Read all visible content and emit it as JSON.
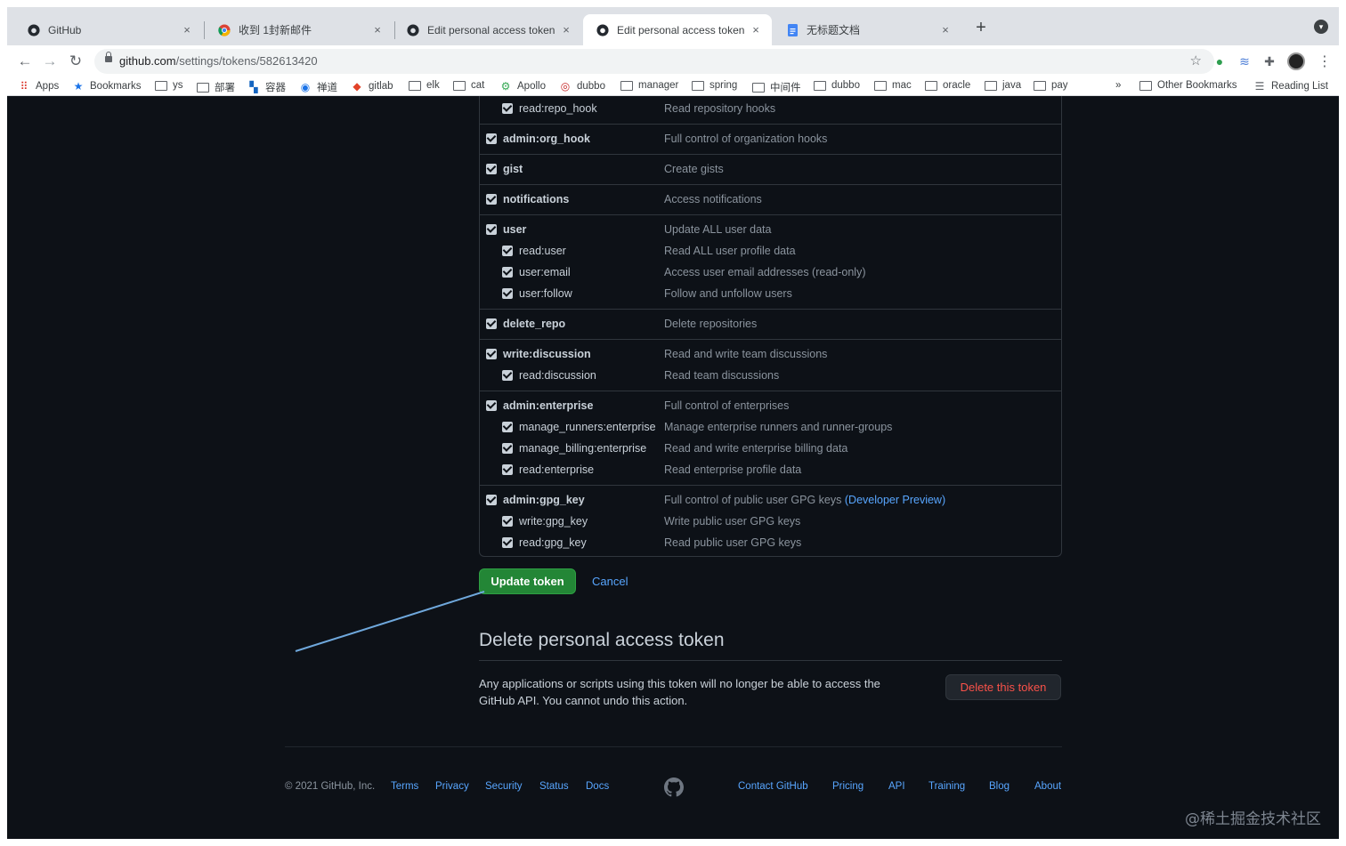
{
  "browser": {
    "tabs": [
      {
        "title": "GitHub",
        "icon": "github-icon",
        "active": false
      },
      {
        "title": "收到 1封新邮件",
        "icon": "chrome-icon",
        "active": false
      },
      {
        "title": "Edit personal access token",
        "icon": "github-icon",
        "active": false
      },
      {
        "title": "Edit personal access token",
        "icon": "github-icon",
        "active": true
      },
      {
        "title": "无标题文档",
        "icon": "docs-icon",
        "active": false
      }
    ],
    "tab_close": "×",
    "new_tab": "+",
    "address": {
      "host": "github.com",
      "path": "/settings/tokens/582613420"
    },
    "bookmarks": [
      {
        "label": "Apps",
        "icon": "apps-icon"
      },
      {
        "label": "Bookmarks",
        "icon": "star-icon"
      },
      {
        "label": "ys",
        "icon": "folder-icon"
      },
      {
        "label": "部署",
        "icon": "folder-icon"
      },
      {
        "label": "容器",
        "icon": "network-icon"
      },
      {
        "label": "禅道",
        "icon": "zentao-icon"
      },
      {
        "label": "gitlab",
        "icon": "gitlab-icon"
      },
      {
        "label": "elk",
        "icon": "folder-icon"
      },
      {
        "label": "cat",
        "icon": "folder-icon"
      },
      {
        "label": "Apollo",
        "icon": "apollo-icon"
      },
      {
        "label": "dubbo",
        "icon": "dubbo-icon"
      },
      {
        "label": "manager",
        "icon": "folder-icon"
      },
      {
        "label": "spring",
        "icon": "folder-icon"
      },
      {
        "label": "中间件",
        "icon": "folder-icon"
      },
      {
        "label": "dubbo",
        "icon": "folder-icon"
      },
      {
        "label": "mac",
        "icon": "folder-icon"
      },
      {
        "label": "oracle",
        "icon": "folder-icon"
      },
      {
        "label": "java",
        "icon": "folder-icon"
      },
      {
        "label": "pay",
        "icon": "folder-icon"
      }
    ],
    "bookmarks_overflow": "»",
    "other_bookmarks": "Other Bookmarks",
    "reading_list": "Reading List"
  },
  "scopes": [
    {
      "name": "read:repo_hook",
      "desc": "Read repository hooks",
      "sub": true
    },
    {
      "name": "admin:org_hook",
      "desc": "Full control of organization hooks",
      "sub": false
    },
    {
      "name": "gist",
      "desc": "Create gists",
      "sub": false
    },
    {
      "name": "notifications",
      "desc": "Access notifications",
      "sub": false
    },
    {
      "name": "user",
      "desc": "Update ALL user data",
      "sub": false
    },
    {
      "name": "read:user",
      "desc": "Read ALL user profile data",
      "sub": true
    },
    {
      "name": "user:email",
      "desc": "Access user email addresses (read-only)",
      "sub": true
    },
    {
      "name": "user:follow",
      "desc": "Follow and unfollow users",
      "sub": true
    },
    {
      "name": "delete_repo",
      "desc": "Delete repositories",
      "sub": false
    },
    {
      "name": "write:discussion",
      "desc": "Read and write team discussions",
      "sub": false
    },
    {
      "name": "read:discussion",
      "desc": "Read team discussions",
      "sub": true
    },
    {
      "name": "admin:enterprise",
      "desc": "Full control of enterprises",
      "sub": false
    },
    {
      "name": "manage_runners:enterprise",
      "desc": "Manage enterprise runners and runner-groups",
      "sub": true
    },
    {
      "name": "manage_billing:enterprise",
      "desc": "Read and write enterprise billing data",
      "sub": true
    },
    {
      "name": "read:enterprise",
      "desc": "Read enterprise profile data",
      "sub": true
    },
    {
      "name": "admin:gpg_key",
      "desc": "Full control of public user GPG keys",
      "link": "(Developer Preview)",
      "sub": false
    },
    {
      "name": "write:gpg_key",
      "desc": "Write public user GPG keys",
      "sub": true
    },
    {
      "name": "read:gpg_key",
      "desc": "Read public user GPG keys",
      "sub": true
    }
  ],
  "actions": {
    "update": "Update token",
    "cancel": "Cancel"
  },
  "delete_section": {
    "title": "Delete personal access token",
    "text": "Any applications or scripts using this token will no longer be able to access the GitHub API. You cannot undo this action.",
    "button": "Delete this token"
  },
  "footer": {
    "copyright": "© 2021 GitHub, Inc.",
    "links_left": [
      "Terms",
      "Privacy",
      "Security",
      "Status",
      "Docs"
    ],
    "links_right": [
      "Contact GitHub",
      "Pricing",
      "API",
      "Training",
      "Blog",
      "About"
    ]
  },
  "watermark": "@稀土掘金技术社区",
  "colors": {
    "accent": "#58a6ff",
    "success": "#238636",
    "danger": "#f85149",
    "background": "#0d1117"
  }
}
